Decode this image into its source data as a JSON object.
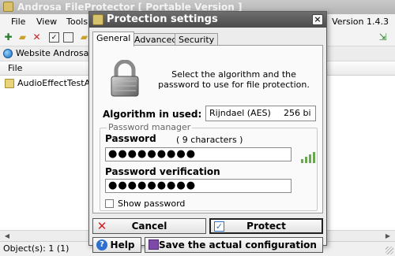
{
  "main": {
    "title": "Androsa FileProtector [ Portable Version ]",
    "menu": [
      "File",
      "View",
      "Tools"
    ],
    "version": "Version 1.4.3",
    "website_label": "Website AndrosaSoft",
    "column_header": "File",
    "files": [
      "AudioEffectTestApp."
    ],
    "status": "Object(s): 1 (1)"
  },
  "dialog": {
    "title": "Protection settings",
    "close_glyph": "×",
    "tabs": [
      "General",
      "Advanced",
      "Security"
    ],
    "active_tab": "General",
    "intro": "Select the algorithm and the password to use for file protection.",
    "algorithm_label": "Algorithm in used:",
    "algorithm_value": "Rijndael (AES)",
    "algorithm_bits": "256 bi",
    "password_manager_legend": "Password manager",
    "password_label": "Password",
    "password_count": "( 9 characters )",
    "password_value": "●●●●●●●●●",
    "verification_label": "Password verification",
    "verification_value": "●●●●●●●●●",
    "show_password_label": "Show password",
    "show_password_checked": false,
    "buttons": {
      "cancel": "Cancel",
      "protect": "Protect",
      "help": "Help",
      "save": "Save the actual configuration"
    }
  },
  "icons": {
    "lock": "padlock-icon",
    "cancel": "red-x-icon",
    "protect": "checkbox-icon",
    "help": "question-icon",
    "save": "floppy-icon"
  },
  "colors": {
    "dialog_title_bg": "#555555",
    "strength_bar": "#6aa84f",
    "cancel_icon": "#d11f1f",
    "protect_icon": "#2e6fd0"
  }
}
